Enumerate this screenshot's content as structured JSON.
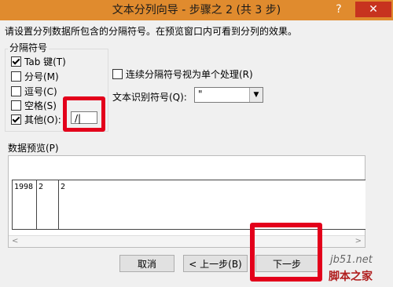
{
  "window": {
    "title": "文本分列向导 - 步骤之 2 (共 3 步)",
    "help_glyph": "?",
    "close_glyph": "✕",
    "accent": "#e08b2e"
  },
  "description": "请设置分列数据所包含的分隔符号。在预览窗口内可看到分列的效果。",
  "delimiters": {
    "group_label": "分隔符号",
    "options": [
      {
        "label": "Tab 键(T)",
        "checked": true
      },
      {
        "label": "分号(M)",
        "checked": false
      },
      {
        "label": "逗号(C)",
        "checked": false
      },
      {
        "label": "空格(S)",
        "checked": false
      },
      {
        "label": "其他(O):",
        "checked": true
      }
    ],
    "other_value": "/|"
  },
  "consecutive": {
    "label": "连续分隔符号视为单个处理(R)",
    "checked": false
  },
  "text_qualifier": {
    "label": "文本识别符号(Q):",
    "value": "\"",
    "arrow": "▼"
  },
  "preview": {
    "label": "数据预览(P)",
    "row": [
      "1998",
      "2",
      "2"
    ],
    "left_arrow": "<",
    "right_arrow": ">"
  },
  "buttons": {
    "cancel": "取消",
    "back": "< 上一步(B)",
    "next": "下一步"
  },
  "watermark": {
    "site": "jb51.net",
    "brand": "脚本之家"
  }
}
